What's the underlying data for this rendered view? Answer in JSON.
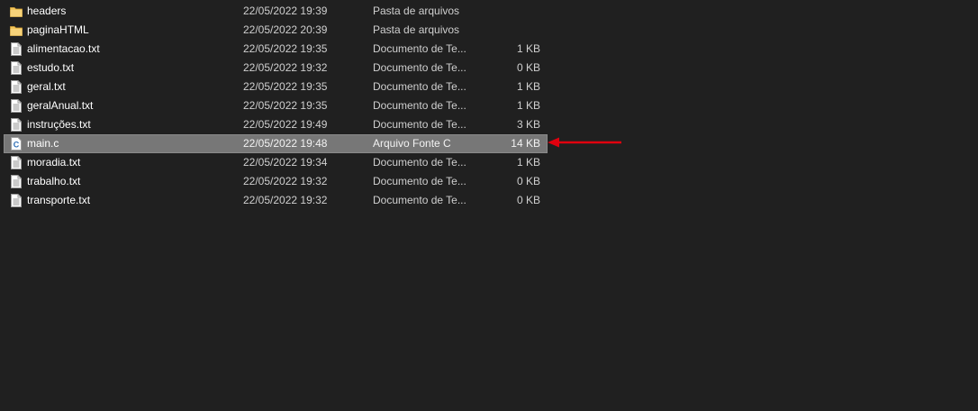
{
  "files": [
    {
      "name": "headers",
      "date": "22/05/2022 19:39",
      "type": "Pasta de arquivos",
      "size": "",
      "icon": "folder-icon"
    },
    {
      "name": "paginaHTML",
      "date": "22/05/2022 20:39",
      "type": "Pasta de arquivos",
      "size": "",
      "icon": "folder-icon"
    },
    {
      "name": "alimentacao.txt",
      "date": "22/05/2022 19:35",
      "type": "Documento de Te...",
      "size": "1 KB",
      "icon": "text-file-icon"
    },
    {
      "name": "estudo.txt",
      "date": "22/05/2022 19:32",
      "type": "Documento de Te...",
      "size": "0 KB",
      "icon": "text-file-icon"
    },
    {
      "name": "geral.txt",
      "date": "22/05/2022 19:35",
      "type": "Documento de Te...",
      "size": "1 KB",
      "icon": "text-file-icon"
    },
    {
      "name": "geralAnual.txt",
      "date": "22/05/2022 19:35",
      "type": "Documento de Te...",
      "size": "1 KB",
      "icon": "text-file-icon"
    },
    {
      "name": "instruções.txt",
      "date": "22/05/2022 19:49",
      "type": "Documento de Te...",
      "size": "3 KB",
      "icon": "text-file-icon"
    },
    {
      "name": "main.c",
      "date": "22/05/2022 19:48",
      "type": "Arquivo Fonte C",
      "size": "14 KB",
      "icon": "c-source-file-icon",
      "selected": true
    },
    {
      "name": "moradia.txt",
      "date": "22/05/2022 19:34",
      "type": "Documento de Te...",
      "size": "1 KB",
      "icon": "text-file-icon"
    },
    {
      "name": "trabalho.txt",
      "date": "22/05/2022 19:32",
      "type": "Documento de Te...",
      "size": "0 KB",
      "icon": "text-file-icon"
    },
    {
      "name": "transporte.txt",
      "date": "22/05/2022 19:32",
      "type": "Documento de Te...",
      "size": "0 KB",
      "icon": "text-file-icon"
    }
  ],
  "colors": {
    "background": "#202020",
    "selection": "#777777",
    "arrow": "#e0000e",
    "folder": "#f2c55c"
  },
  "annotation": {
    "icon": "red-arrow-icon"
  }
}
